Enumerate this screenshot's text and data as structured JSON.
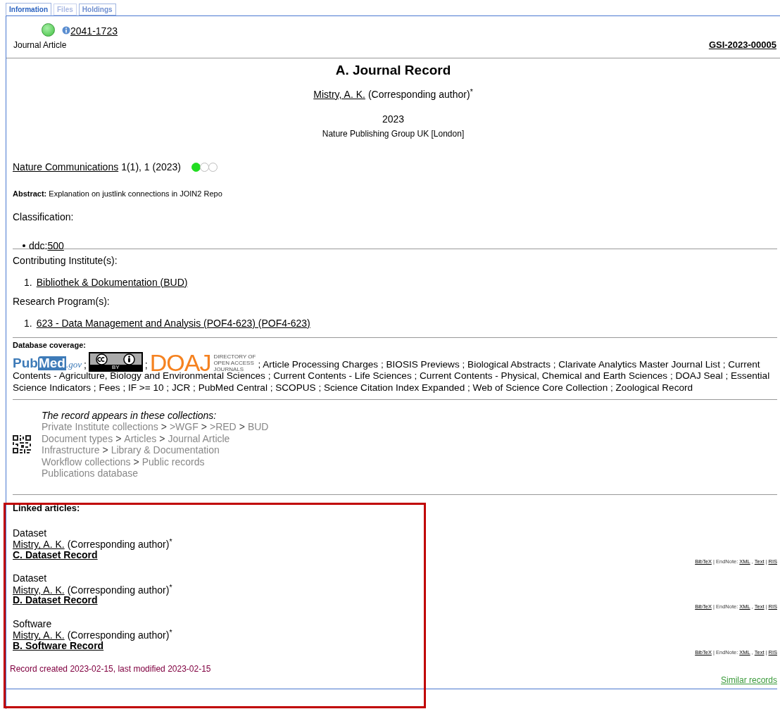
{
  "tabs": [
    {
      "label": "Information",
      "selected": true,
      "disabled": false
    },
    {
      "label": "Files",
      "selected": false,
      "disabled": true
    },
    {
      "label": "Holdings",
      "selected": false,
      "disabled": false
    }
  ],
  "header": {
    "issn": "2041-1723",
    "doc_type": "Journal Article",
    "record_id": "GSI-2023-00005"
  },
  "title": "A. Journal Record",
  "author": {
    "name": "Mistry, A. K.",
    "role": "(Corresponding author)",
    "mark": "*"
  },
  "year": "2023",
  "publisher": "Nature Publishing Group UK [London]",
  "journal": {
    "name": "Nature Communications",
    "citation": "1(1), 1 (2023)",
    "oa_dots": [
      {
        "on": true
      },
      {
        "on": false
      },
      {
        "on": false
      }
    ]
  },
  "abstract": {
    "label": "Abstract:",
    "text": "Explanation on justlink connections in JOIN2 Repo"
  },
  "classification": {
    "label": "Classification:",
    "items": [
      {
        "prefix": "ddc:",
        "code": "500"
      }
    ]
  },
  "institutes": {
    "label": "Contributing Institute(s):",
    "items": [
      {
        "number": "1.",
        "text": "Bibliothek & Dokumentation (BUD)"
      }
    ]
  },
  "programs": {
    "label": "Research Program(s):",
    "items": [
      {
        "number": "1.",
        "text": "623 - Data Management and Analysis (POF4-623) (POF4-623)"
      }
    ]
  },
  "coverage": {
    "label": "Database coverage:",
    "separator": ";",
    "logos": [
      {
        "kind": "pubmed",
        "parts": [
          "Pub",
          "Med",
          ".gov"
        ]
      },
      {
        "kind": "cc",
        "text": "BY"
      },
      {
        "kind": "doaj",
        "text": "DOAJ",
        "lines": [
          "DIRECTORY OF",
          "OPEN ACCESS",
          "JOURNALS"
        ]
      }
    ],
    "lines": [
      "; Article Processing Charges ; BIOSIS Previews ; Biological Abstracts ; Clarivate Analytics Master Journal List ; Current",
      "Contents - Agriculture, Biology and Environmental Sciences ; Current Contents - Life Sciences ; Current Contents - Physical, Chemical and Earth Sciences ; DOAJ Seal ; Essential",
      "Science Indicators ; Fees ; IF >= 10 ; JCR ; PubMed Central ; SCOPUS ; Science Citation Index Expanded ; Web of Science Core Collection ; Zoological Record"
    ]
  },
  "collections": {
    "heading": "The record appears in these collections:",
    "separator": ">",
    "paths": [
      [
        "Private Institute collections",
        ">WGF",
        ">RED",
        "BUD"
      ],
      [
        "Document types",
        "Articles",
        "Journal Article"
      ],
      [
        "Infrastructure",
        "Library & Documentation"
      ],
      [
        "Workflow collections",
        "Public records"
      ],
      [
        "Publications database"
      ]
    ]
  },
  "linked": {
    "heading": "Linked articles:",
    "highlighted": true,
    "items": [
      {
        "type": "Dataset",
        "author": "Mistry, A. K.",
        "role": "(Corresponding author)",
        "mark": "*",
        "title": "C. Dataset Record",
        "export": [
          {
            "text": "BibTeX",
            "link": true
          },
          {
            "text": "| EndNote:",
            "link": false
          },
          {
            "text": "XML",
            "link": true
          },
          {
            "text": ",",
            "link": false
          },
          {
            "text": "Text",
            "link": true
          },
          {
            "text": "|",
            "link": false
          },
          {
            "text": "RIS",
            "link": true
          }
        ]
      },
      {
        "type": "Dataset",
        "author": "Mistry, A. K.",
        "role": "(Corresponding author)",
        "mark": "*",
        "title": "D. Dataset Record",
        "export": [
          {
            "text": "BibTeX",
            "link": true
          },
          {
            "text": "| EndNote:",
            "link": false
          },
          {
            "text": "XML",
            "link": true
          },
          {
            "text": ",",
            "link": false
          },
          {
            "text": "Text",
            "link": true
          },
          {
            "text": "|",
            "link": false
          },
          {
            "text": "RIS",
            "link": true
          }
        ]
      },
      {
        "type": "Software",
        "author": "Mistry, A. K.",
        "role": "(Corresponding author)",
        "mark": "*",
        "title": "B. Software Record",
        "export": [
          {
            "text": "BibTeX",
            "link": true
          },
          {
            "text": "| EndNote:",
            "link": false
          },
          {
            "text": "XML",
            "link": true
          },
          {
            "text": ",",
            "link": false
          },
          {
            "text": "Text",
            "link": true
          },
          {
            "text": "|",
            "link": false
          },
          {
            "text": "RIS",
            "link": true
          }
        ]
      }
    ]
  },
  "footer": {
    "created": "Record created 2023-02-15, last modified 2023-02-15",
    "similar": "Similar records"
  }
}
